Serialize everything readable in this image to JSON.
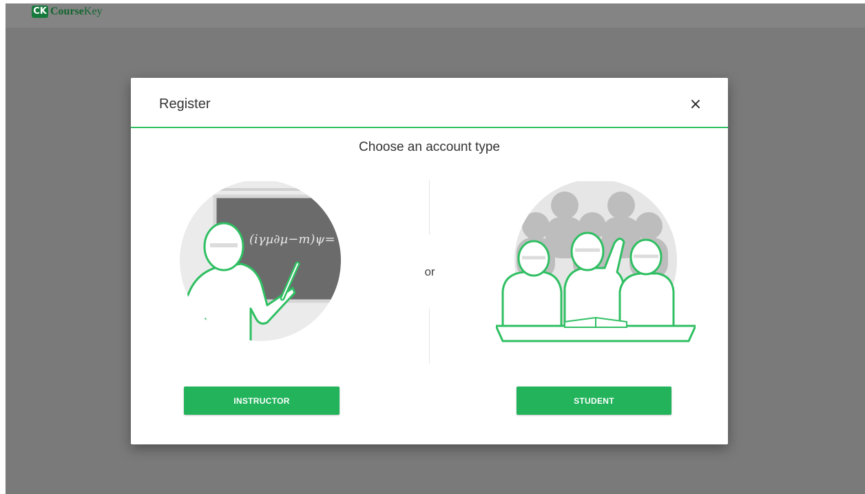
{
  "app": {
    "logo_mark": "CK",
    "logo_text_bold": "Course",
    "logo_text_light": "Key"
  },
  "modal": {
    "title": "Register",
    "close_glyph": "×",
    "subtitle": "Choose an account type",
    "separator": "or",
    "instructor": {
      "button_label": "INSTRUCTOR",
      "illustration": "instructor-at-blackboard-illustration",
      "blackboard_text": "(iγµ∂µ−m)ψ="
    },
    "student": {
      "button_label": "STUDENT",
      "illustration": "students-in-classroom-illustration"
    }
  },
  "colors": {
    "accent": "#22b35b",
    "header_underline": "#2fbf62",
    "overlay": "#7a7a7a",
    "logo": "#167a3c"
  }
}
